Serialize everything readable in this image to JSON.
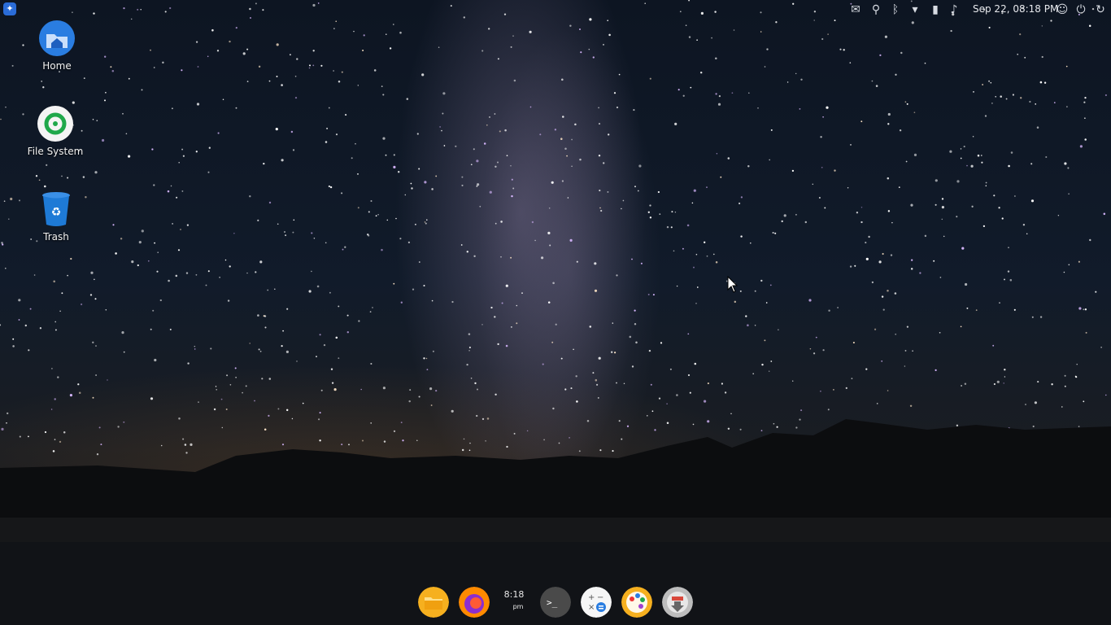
{
  "topbar": {
    "datetime": "Sep 22, 08:18 PM",
    "icons": [
      "launcher-icon",
      "mail-icon",
      "location-icon",
      "bluetooth-icon",
      "wifi-icon",
      "battery-icon",
      "volume-icon",
      "users-icon",
      "power-icon",
      "refresh-icon"
    ]
  },
  "desktop": {
    "icons": [
      {
        "label": "Home",
        "icon": "home-folder-icon"
      },
      {
        "label": "File System",
        "icon": "file-system-icon"
      },
      {
        "label": "Trash",
        "icon": "trash-icon"
      }
    ]
  },
  "dock": {
    "clock_time": "8:18",
    "clock_ampm": "pm",
    "apps": [
      "file-manager-icon",
      "firefox-icon",
      "terminal-icon",
      "calculator-icon",
      "paint-icon",
      "installer-icon"
    ]
  },
  "colors": {
    "accent": "#2a6cd8",
    "folder": "#f6b01f",
    "trash": "#1e7ad6",
    "fs_ring": "#1fa84a"
  }
}
